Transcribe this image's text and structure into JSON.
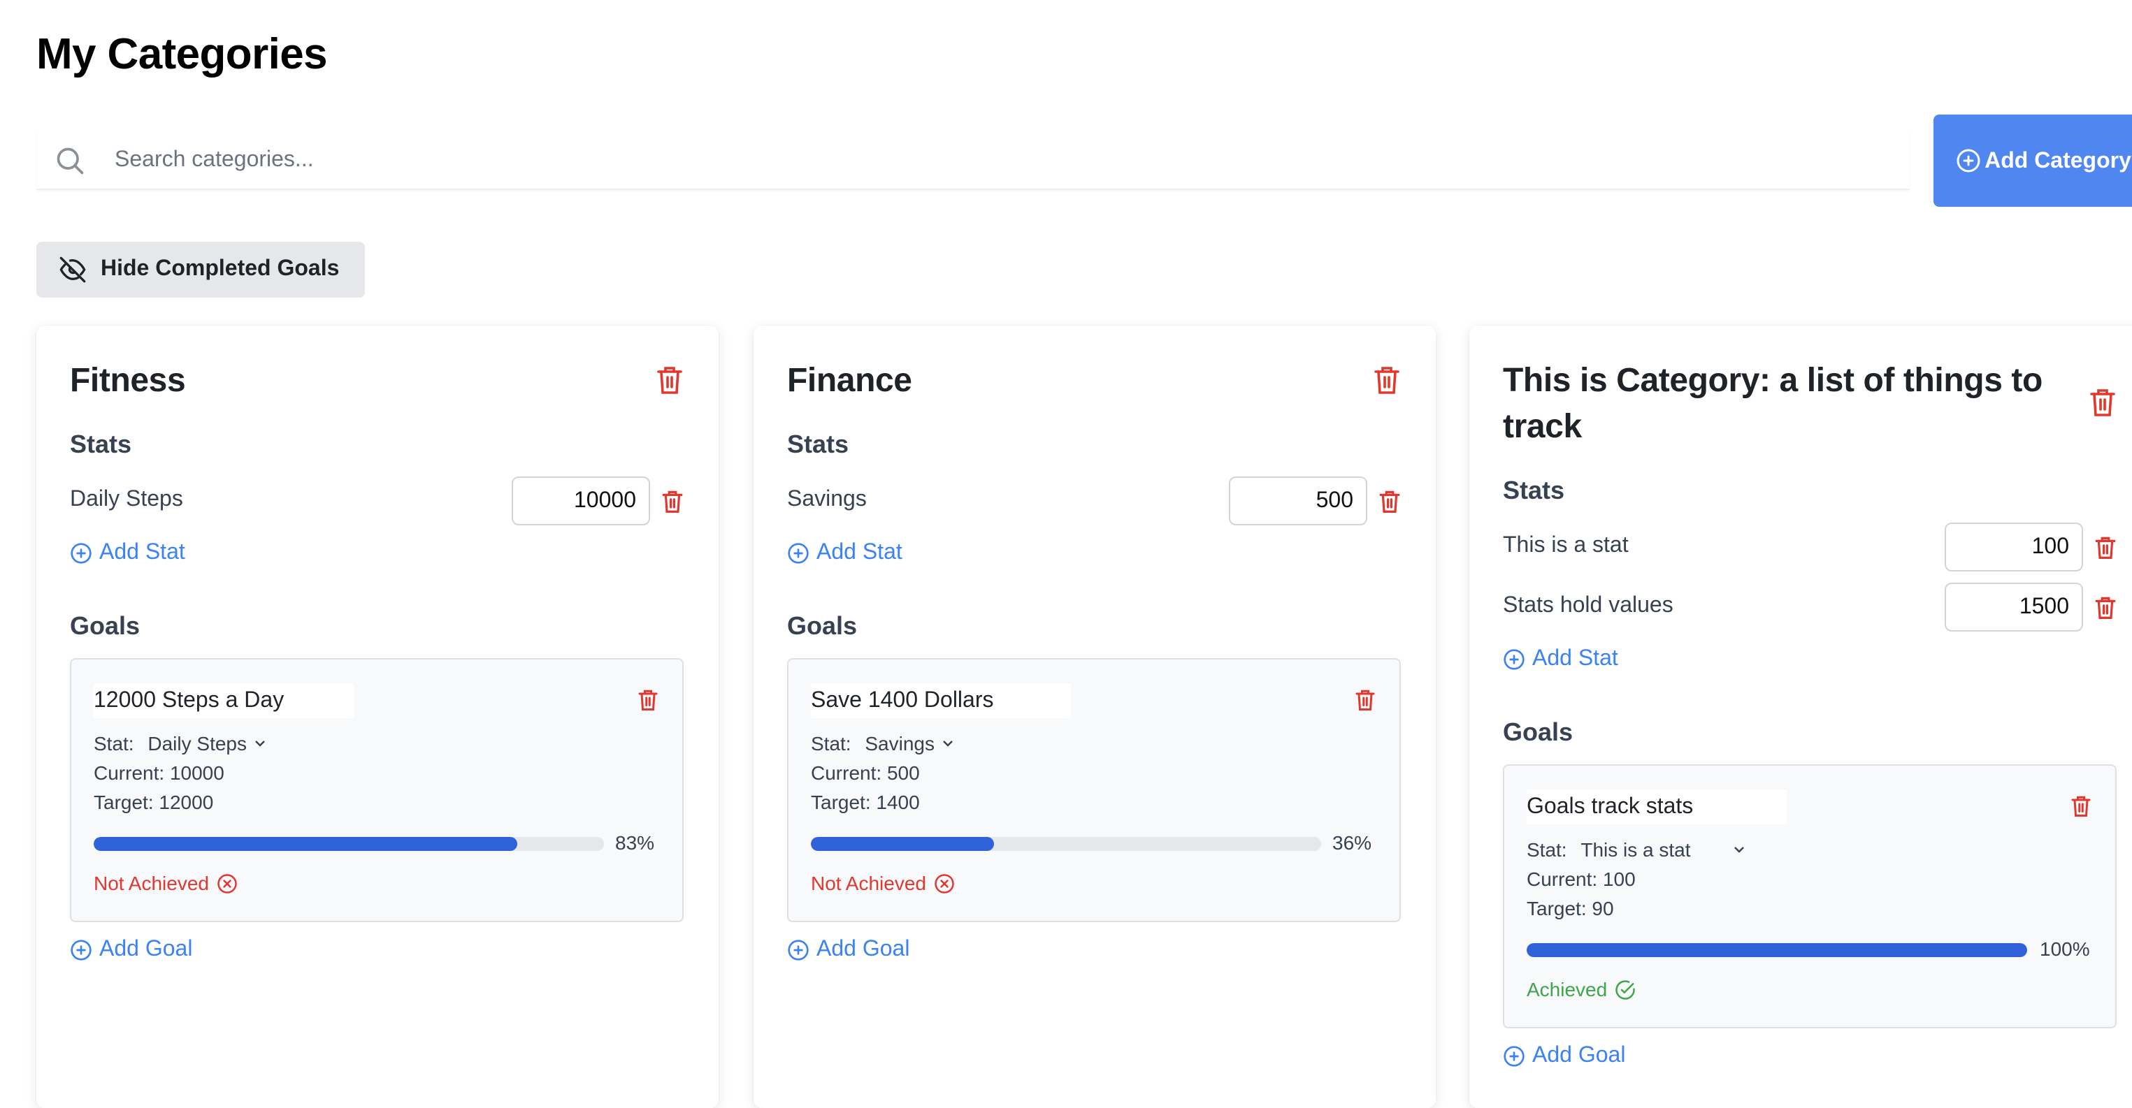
{
  "page": {
    "title": "My Categories"
  },
  "search": {
    "placeholder": "Search categories..."
  },
  "toolbar": {
    "add_category_label": "Add Category",
    "hide_completed_label": "Hide Completed Goals"
  },
  "labels": {
    "stats": "Stats",
    "goals": "Goals",
    "add_stat": "Add Stat",
    "add_goal": "Add Goal",
    "stat_prefix": "Stat:",
    "current_prefix": "Current:",
    "target_prefix": "Target:"
  },
  "colors": {
    "accent": "#4f86f0",
    "link": "#3b82f6",
    "danger": "#e0382f",
    "success": "#3fa54a",
    "progress": "#2f62d8"
  },
  "categories": [
    {
      "name": "Fitness",
      "stats": [
        {
          "name": "Daily Steps",
          "value": "10000"
        }
      ],
      "goals": [
        {
          "title": "12000 Steps a Day",
          "stat": "Daily Steps",
          "current": "10000",
          "target": "12000",
          "progress": 83,
          "progress_label": "83%",
          "status": "Not Achieved"
        }
      ]
    },
    {
      "name": "Finance",
      "stats": [
        {
          "name": "Savings",
          "value": "500"
        }
      ],
      "goals": [
        {
          "title": "Save 1400 Dollars",
          "stat": "Savings",
          "current": "500",
          "target": "1400",
          "progress": 36,
          "progress_label": "36%",
          "status": "Not Achieved"
        }
      ]
    },
    {
      "name": "This is Category: a list of things to track",
      "stats": [
        {
          "name": "This is a stat",
          "value": "100"
        },
        {
          "name": "Stats hold values",
          "value": "1500"
        }
      ],
      "goals": [
        {
          "title": "Goals track stats",
          "stat": "This is a stat",
          "current": "100",
          "target": "90",
          "progress": 100,
          "progress_label": "100%",
          "status": "Achieved"
        }
      ]
    }
  ]
}
